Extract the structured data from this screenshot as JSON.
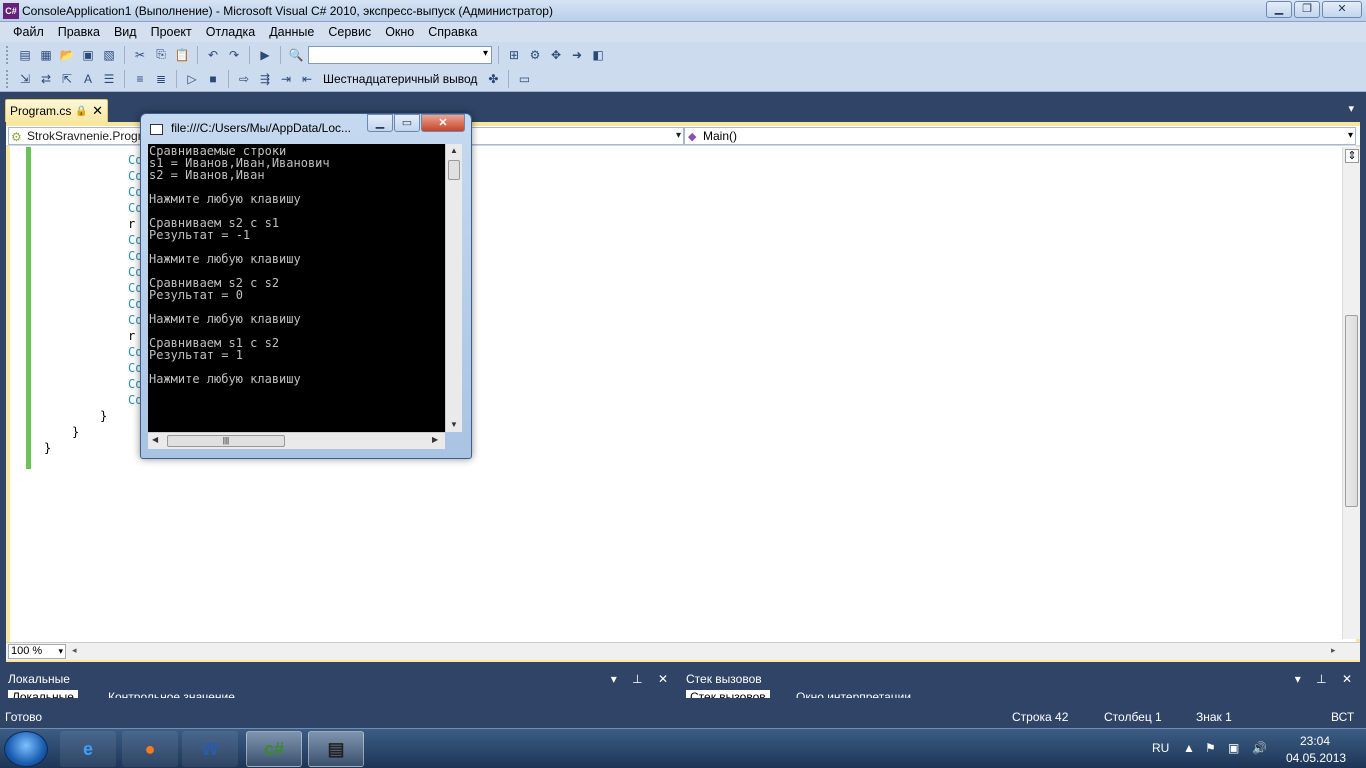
{
  "window": {
    "title": "ConsoleApplication1 (Выполнение) - Microsoft Visual C# 2010, экспресс-выпуск (Администратор)",
    "app_icon": "C#"
  },
  "menu": [
    "Файл",
    "Правка",
    "Вид",
    "Проект",
    "Отладка",
    "Данные",
    "Сервис",
    "Окно",
    "Справка"
  ],
  "toolbar2": {
    "hex_label": "Шестнадцатеричный вывод"
  },
  "doc_tab": {
    "label": "Program.cs"
  },
  "nav": {
    "left": "StrokSravnenie.Program",
    "right": "Main()"
  },
  "code": {
    "lines": [
      "Co",
      "Co",
      "Co",
      "Co",
      "r",
      "Co",
      "Co",
      "Co",
      "Co",
      "Co",
      "Co",
      "r",
      "Co",
      "Co",
      "Co",
      "Co"
    ],
    "closing": [
      "}",
      "}",
      "}"
    ]
  },
  "zoom": "100 %",
  "panels": {
    "left": {
      "title": "Локальные",
      "tabs": [
        "Локальные",
        "Контрольное значение"
      ]
    },
    "right": {
      "title": "Стек вызовов",
      "tabs": [
        "Стек вызовов",
        "Окно интерпретации"
      ]
    }
  },
  "status": {
    "ready": "Готово",
    "line": "Строка 42",
    "col": "Столбец 1",
    "char": "Знак 1",
    "mode": "ВСТ"
  },
  "console": {
    "title": "file:///C:/Users/Мы/AppData/Loc...",
    "lines": [
      "Сравниваемые строки",
      "s1 = Иванов,Иван,Иванович",
      "s2 = Иванов,Иван",
      "",
      "Нажмите любую клавишу",
      "",
      "Сравниваем s2 с s1",
      "Результат = -1",
      "",
      "Нажмите любую клавишу",
      "",
      "Сравниваем s2 с s2",
      "Результат = 0",
      "",
      "Нажмите любую клавишу",
      "",
      "Сравниваем s1 с s2",
      "Результат = 1",
      "",
      "Нажмите любую клавишу"
    ]
  },
  "taskbar": {
    "lang": "RU",
    "time": "23:04",
    "date": "04.05.2013",
    "apps": [
      "ie-icon",
      "firefox-icon",
      "word-icon",
      "csharp-icon",
      "console-icon"
    ],
    "word_glyph": "W",
    "csharp_glyph": "c#"
  }
}
